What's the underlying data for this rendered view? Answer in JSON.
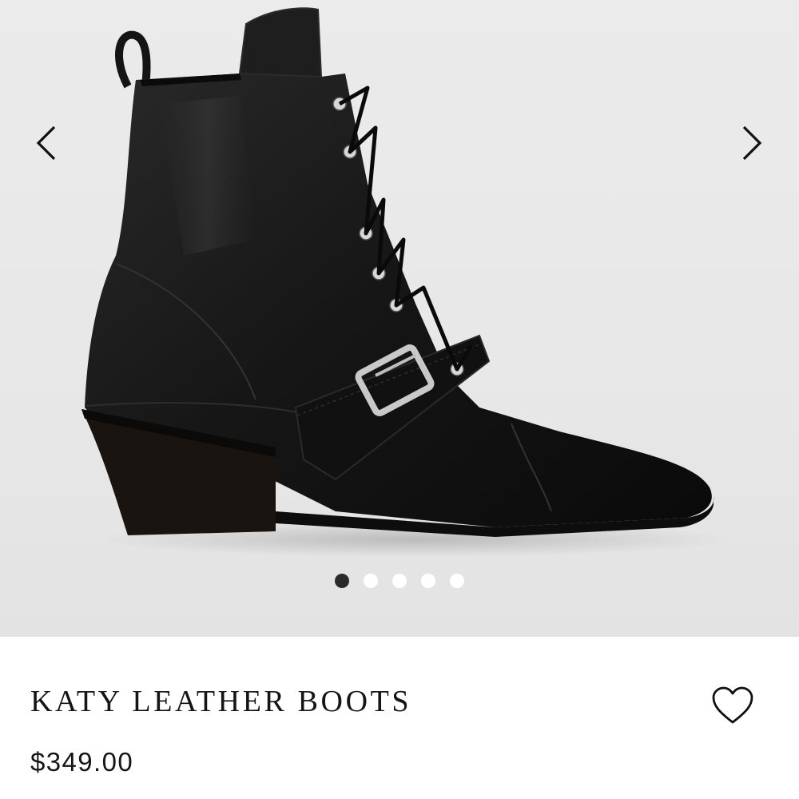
{
  "gallery": {
    "image_subject": "black leather lace-up ankle boot with buckle strap",
    "prev_icon": "chevron-left-icon",
    "next_icon": "chevron-right-icon",
    "slide_count": 5,
    "active_slide": 1
  },
  "product": {
    "title": "KATY LEATHER BOOTS",
    "price": "$349.00"
  },
  "wishlist": {
    "icon": "heart-outline-icon"
  },
  "colors": {
    "gallery_bg": "#e9e9e9",
    "dot_active": "#2a2a2a",
    "dot_inactive": "#ffffff",
    "text": "#151515"
  }
}
